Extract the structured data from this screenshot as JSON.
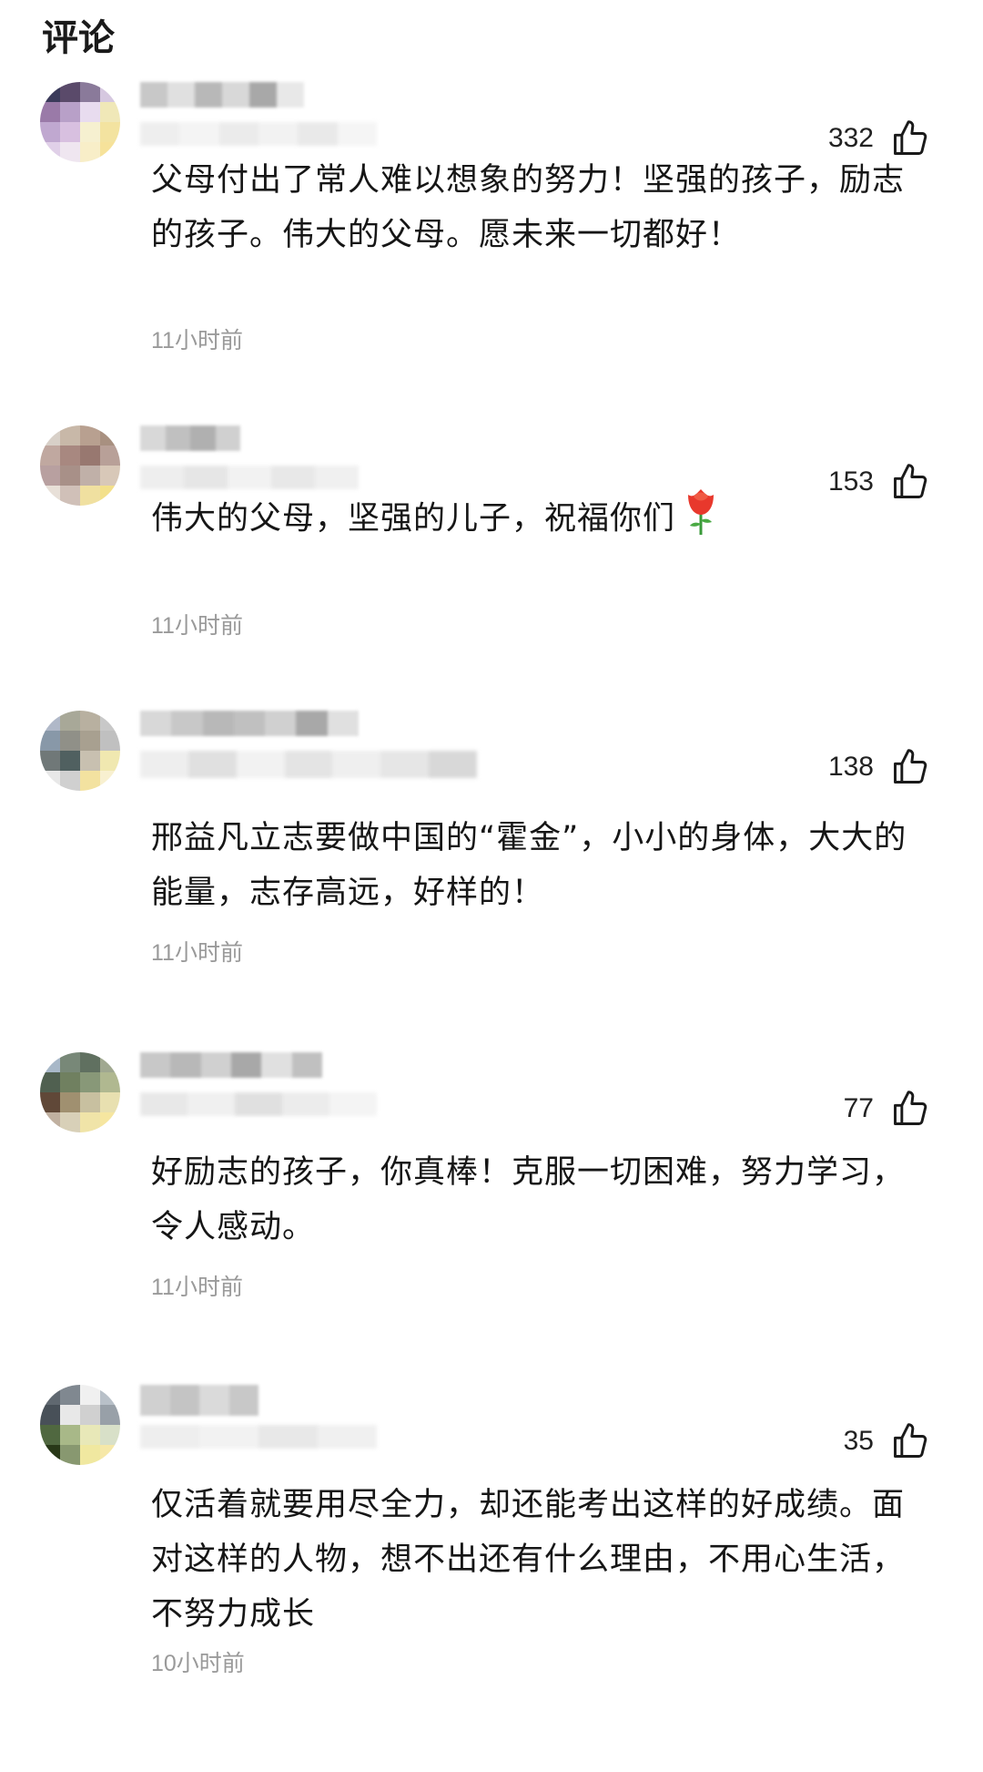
{
  "header": {
    "title": "评论"
  },
  "comments": [
    {
      "likes": "332",
      "text": "父母付出了常人难以想象的努力！坚强的孩子，励志的孩子。伟大的父母。愿未来一切都好！",
      "time": "11小时前",
      "avatar_colors": [
        "#3a3a5a",
        "#5a4a6a",
        "#8a7a9a",
        "#d6c8e0",
        "#9a7aa8",
        "#b8a0c8",
        "#e8dcef",
        "#f0e8b8",
        "#c0a8d0",
        "#d8c0e0",
        "#f6f0d0",
        "#f3e3a0",
        "#e0d0e8",
        "#efe6f0",
        "#f8eec8",
        "#f6e29a"
      ]
    },
    {
      "likes": "153",
      "text": "伟大的父母，坚强的儿子，祝福你们",
      "emoji": "rose",
      "time": "11小时前",
      "avatar_colors": [
        "#d8d0c8",
        "#c8b8a8",
        "#b8a090",
        "#a89080",
        "#c0a8a0",
        "#a88880",
        "#987870",
        "#b8a098",
        "#b8a0a0",
        "#a89088",
        "#c0b0a8",
        "#d8c8b8",
        "#e8e0d8",
        "#d0c0b8",
        "#f0e0a0",
        "#f3e08a"
      ]
    },
    {
      "likes": "138",
      "text": "邢益凡立志要做中国的“霍金”，小小的身体，大大的能量，志存高远，好样的！",
      "time": "11小时前",
      "avatar_colors": [
        "#b0b8c8",
        "#a8a898",
        "#b8b0a0",
        "#c8c8c8",
        "#8898a8",
        "#909088",
        "#a8a090",
        "#c0c0c0",
        "#707878",
        "#506060",
        "#c8c0b0",
        "#f0e8b0",
        "#e8e8e8",
        "#d0d0d0",
        "#f3e2a0",
        "#f8f0d0"
      ]
    },
    {
      "likes": "77",
      "text": "好励志的孩子，你真棒！克服一切困难，努力学习，令人感动。",
      "time": "11小时前",
      "avatar_colors": [
        "#a8b8c8",
        "#788878",
        "#607060",
        "#a0a890",
        "#506050",
        "#708060",
        "#889878",
        "#b0b890",
        "#604838",
        "#a09070",
        "#c8c0a0",
        "#e8e0b0",
        "#c0b0a0",
        "#d8d0b8",
        "#f0e4a8",
        "#f6e6a0"
      ]
    },
    {
      "likes": "35",
      "text": "仅活着就要用尽全力，却还能考出这样的好成绩。面对这样的人物，想不出还有什么理由，不用心生活，不努力成长",
      "time": "10小时前",
      "avatar_colors": [
        "#606870",
        "#808890",
        "#f0f0f0",
        "#b8c0c8",
        "#485058",
        "#e8e8e8",
        "#d0d0d0",
        "#98a0a8",
        "#506840",
        "#a8b888",
        "#e8e8b8",
        "#d8e0c8",
        "#283818",
        "#889870",
        "#f0e8a0",
        "#f6e8a8"
      ]
    }
  ],
  "colors": {
    "time": "#9a9a9a",
    "text": "#161616",
    "background": "#ffffff"
  }
}
